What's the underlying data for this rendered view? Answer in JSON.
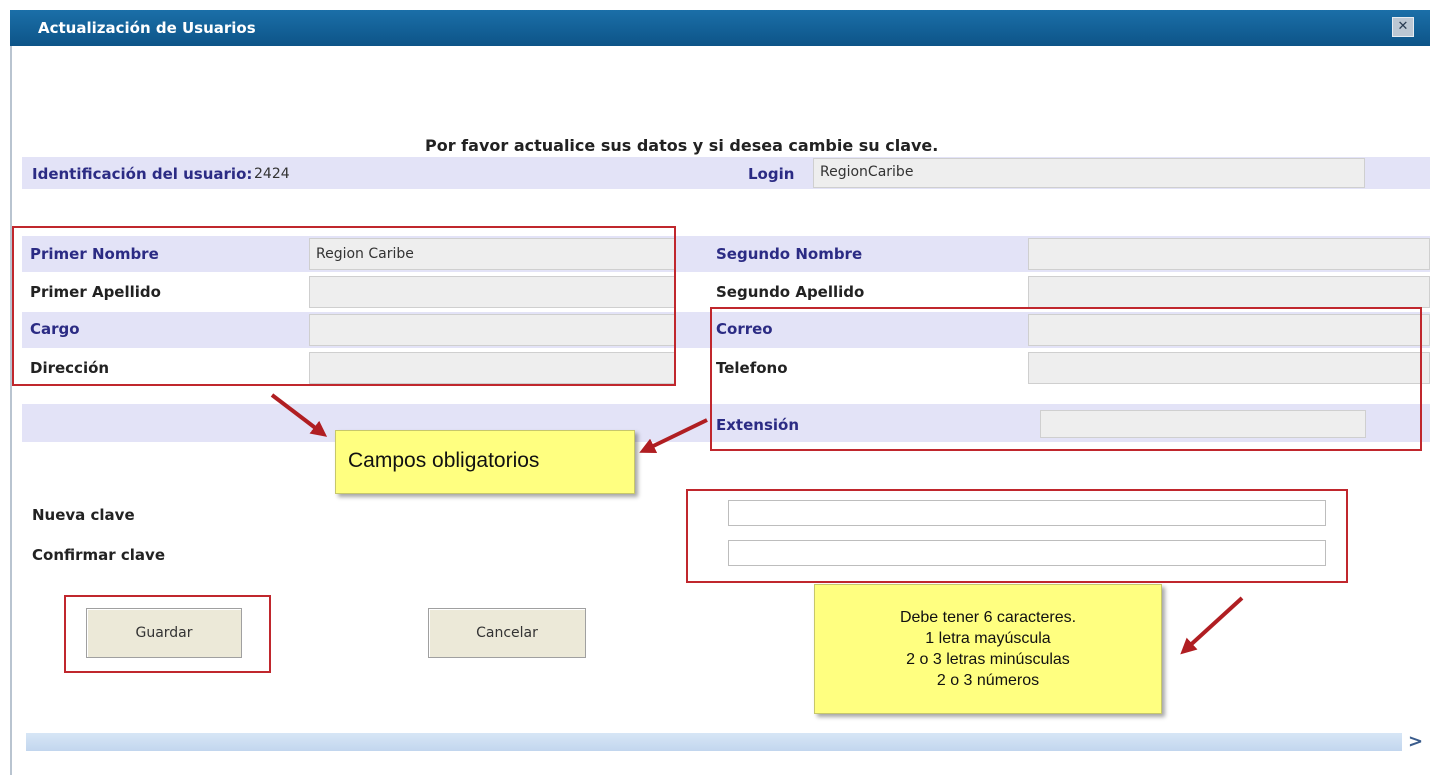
{
  "window": {
    "title": "Actualización de Usuarios",
    "close_glyph": "✕"
  },
  "intro": "Por favor actualice sus datos y si desea cambie su clave.",
  "identification": {
    "label": "Identificación del usuario:",
    "value": "2424"
  },
  "login": {
    "label": "Login",
    "value": "RegionCaribe"
  },
  "fields": {
    "primer_nombre": {
      "label": "Primer Nombre",
      "value": "Region Caribe"
    },
    "segundo_nombre": {
      "label": "Segundo Nombre",
      "value": ""
    },
    "primer_apellido": {
      "label": "Primer Apellido",
      "value": ""
    },
    "segundo_apellido": {
      "label": "Segundo Apellido",
      "value": ""
    },
    "cargo": {
      "label": "Cargo",
      "value": ""
    },
    "correo": {
      "label": "Correo",
      "value": ""
    },
    "direccion": {
      "label": "Dirección",
      "value": ""
    },
    "telefono": {
      "label": "Telefono",
      "value": ""
    },
    "extension": {
      "label": "Extensión",
      "value": ""
    }
  },
  "password": {
    "new_label": "Nueva clave",
    "confirm_label": "Confirmar clave",
    "new_value": "",
    "confirm_value": ""
  },
  "buttons": {
    "save": "Guardar",
    "cancel": "Cancelar"
  },
  "callouts": {
    "required": "Campos obligatorios",
    "rules": [
      "Debe tener 6 caracteres.",
      "1 letra mayúscula",
      "2 o 3 letras minúsculas",
      "2 o 3 números"
    ]
  },
  "scrollbar": {
    "left_glyph": "<",
    "right_glyph": ">"
  },
  "colors": {
    "titlebar": "#0d5488",
    "band": "#e3e3f7",
    "highlight_box": "#c0272d",
    "callout": "#ffff80"
  }
}
